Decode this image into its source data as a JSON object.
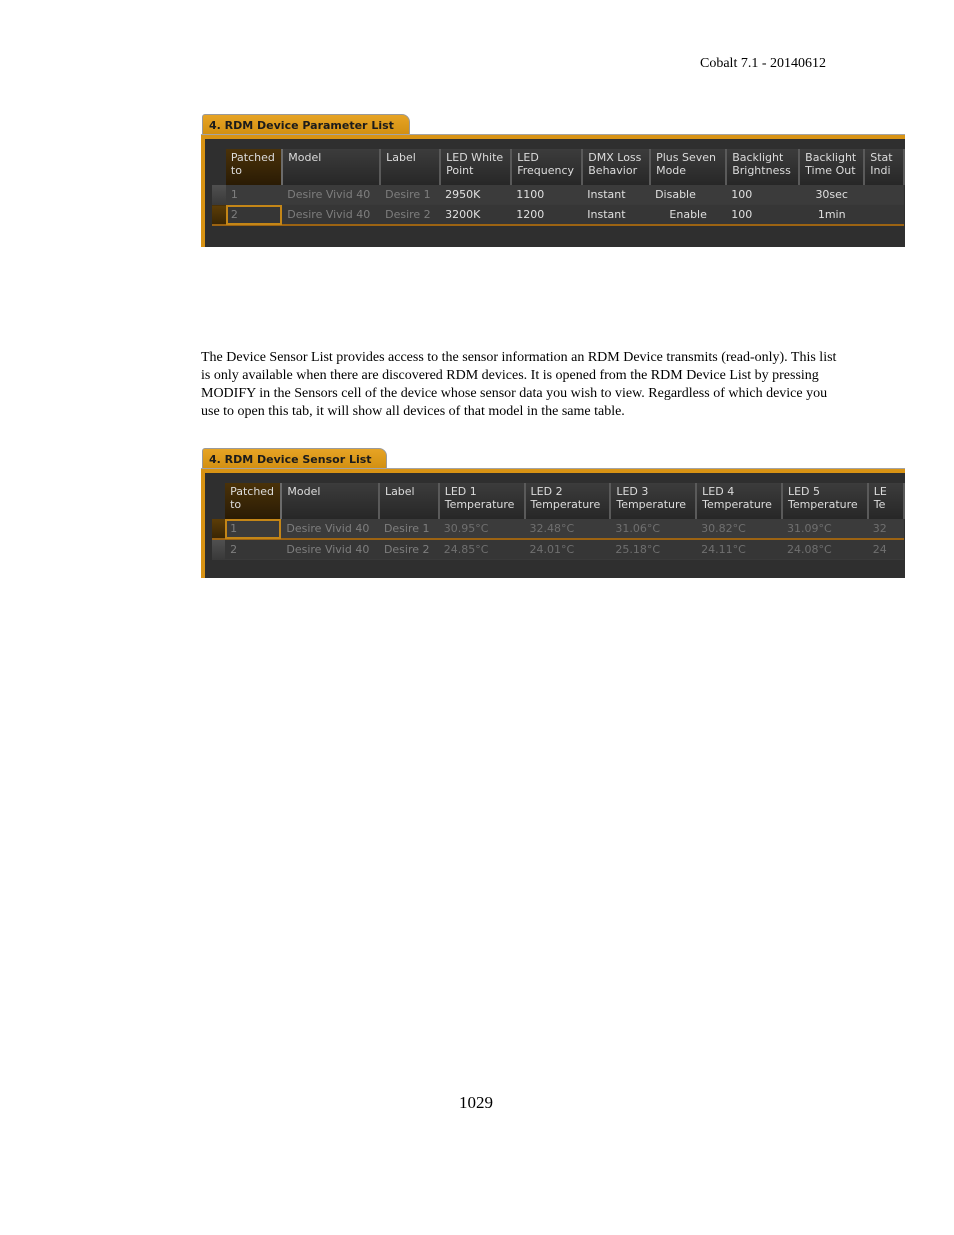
{
  "page": {
    "running_header": "Cobalt 7.1 - 20140612",
    "page_number": "1029",
    "paragraph": "The Device Sensor List provides access to the sensor information an RDM Device transmits (read-only). This list is only available when there are discovered RDM devices. It is opened from the RDM Device List by pressing MODIFY in the Sensors cell of the device whose sensor data you wish to view. Regardless of which device you use to open this tab, it will show all devices of that model in the same table."
  },
  "parameter_list": {
    "tab_label": "4. RDM Device Parameter List",
    "columns": [
      [
        "Patched",
        "to"
      ],
      [
        "Model",
        ""
      ],
      [
        "Label",
        ""
      ],
      [
        "LED White",
        "Point"
      ],
      [
        "LED",
        "Frequency"
      ],
      [
        "DMX Loss",
        "Behavior"
      ],
      [
        "Plus Seven",
        "Mode"
      ],
      [
        "Backlight",
        "Brightness"
      ],
      [
        "Backlight",
        "Time Out"
      ],
      [
        "Stat",
        "Indi"
      ]
    ],
    "rows": [
      {
        "patched": "1",
        "model": "Desire Vivid 40",
        "label": "Desire 1",
        "white_point": "2950K",
        "frequency": "1100",
        "dmx_loss": "Instant",
        "plus_seven": "Disable",
        "brightness": "100",
        "time_out": "30sec",
        "status": ""
      },
      {
        "patched": "2",
        "model": "Desire Vivid 40",
        "label": "Desire 2",
        "white_point": "3200K",
        "frequency": "1200",
        "dmx_loss": "Instant",
        "plus_seven": "Enable",
        "brightness": "100",
        "time_out": "1min",
        "status": ""
      }
    ],
    "selected_row": 2
  },
  "sensor_list": {
    "tab_label": "4. RDM Device Sensor List",
    "columns": [
      [
        "Patched",
        "to"
      ],
      [
        "Model",
        ""
      ],
      [
        "Label",
        ""
      ],
      [
        "LED 1",
        "Temperature"
      ],
      [
        "LED 2",
        "Temperature"
      ],
      [
        "LED 3",
        "Temperature"
      ],
      [
        "LED 4",
        "Temperature"
      ],
      [
        "LED 5",
        "Temperature"
      ],
      [
        "LE",
        "Te"
      ]
    ],
    "rows": [
      {
        "patched": "1",
        "model": "Desire Vivid 40",
        "label": "Desire 1",
        "led1": "30.95°C",
        "led2": "32.48°C",
        "led3": "31.06°C",
        "led4": "30.82°C",
        "led5": "31.09°C",
        "led6": "32"
      },
      {
        "patched": "2",
        "model": "Desire Vivid 40",
        "label": "Desire 2",
        "led1": "24.85°C",
        "led2": "24.01°C",
        "led3": "25.18°C",
        "led4": "24.11°C",
        "led5": "24.08°C",
        "led6": "24"
      }
    ],
    "selected_row": 1
  },
  "colors": {
    "accent_orange": "#d89314",
    "panel_background": "#2f2f2f"
  }
}
